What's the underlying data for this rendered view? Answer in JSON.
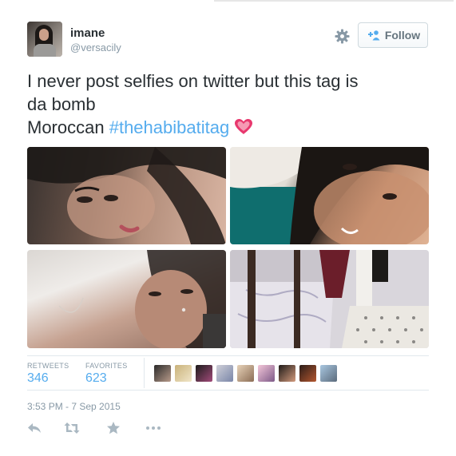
{
  "user": {
    "name": "imane",
    "handle": "@versacily"
  },
  "follow_label": "Follow",
  "tweet": {
    "line1": "I never post selfies on twitter but this tag is",
    "line2": "da bomb",
    "line3_prefix": "Moroccan ",
    "hashtag": "#thehabibatitag"
  },
  "stats": {
    "retweets_label": "RETWEETS",
    "retweets_value": "346",
    "favorites_label": "FAVORITES",
    "favorites_value": "623"
  },
  "timestamp": "3:53 PM - 7 Sep 2015",
  "icons": {
    "settings": "gear-icon",
    "follow": "add-user-icon",
    "emoji": "sparkling-heart-emoji",
    "actions": [
      "reply-icon",
      "retweet-icon",
      "favorite-icon",
      "more-icon"
    ]
  },
  "colors": {
    "link": "#55acee",
    "muted": "#8899a6",
    "text": "#292f33"
  }
}
